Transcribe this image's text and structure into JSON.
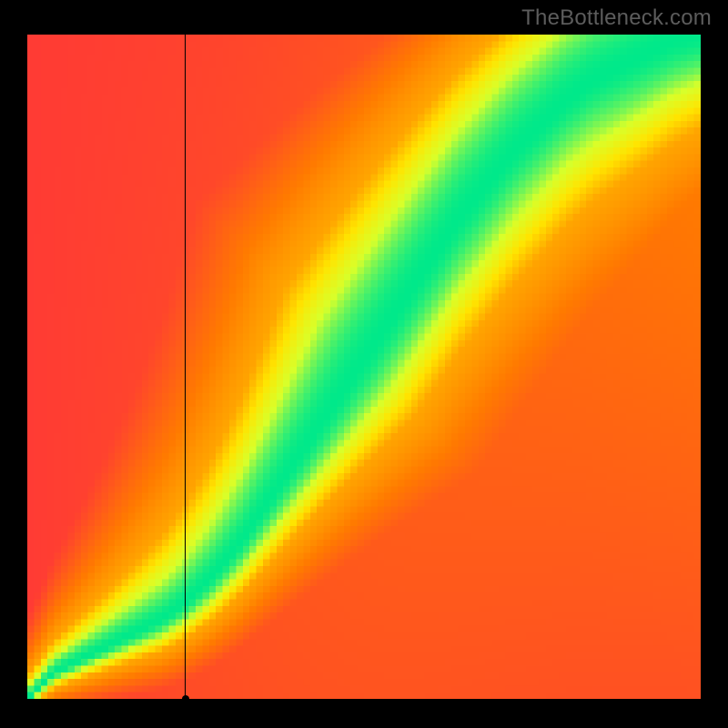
{
  "watermark": "TheBottleneck.com",
  "chart_data": {
    "type": "heatmap",
    "title": "",
    "xlabel": "",
    "ylabel": "",
    "xlim": [
      0,
      100
    ],
    "ylim": [
      0,
      100
    ],
    "grid": false,
    "legend": false,
    "color_scale": [
      "#ff1a4f",
      "#ff6a00",
      "#ffd400",
      "#e6ff1a",
      "#00e98a"
    ],
    "optimal_ridge": {
      "description": "Green optimal band through the heatmap; coordinates are (x%, y%) of plot area from bottom-left.",
      "points": [
        [
          0,
          0
        ],
        [
          4,
          4
        ],
        [
          8,
          6
        ],
        [
          12,
          8
        ],
        [
          16,
          10
        ],
        [
          20,
          12
        ],
        [
          24,
          15
        ],
        [
          28,
          19
        ],
        [
          32,
          24
        ],
        [
          36,
          30
        ],
        [
          40,
          36
        ],
        [
          44,
          42
        ],
        [
          48,
          48
        ],
        [
          52,
          54
        ],
        [
          56,
          60
        ],
        [
          60,
          66
        ],
        [
          64,
          72
        ],
        [
          68,
          77
        ],
        [
          72,
          82
        ],
        [
          76,
          86
        ],
        [
          80,
          90
        ],
        [
          84,
          93
        ],
        [
          88,
          95
        ],
        [
          92,
          97
        ],
        [
          96,
          99
        ],
        [
          100,
          100
        ]
      ],
      "band_halfwidth_pct_at_50": 4
    },
    "crosshair": {
      "x_pct": 23.5,
      "y_pct": 0,
      "marker": true
    },
    "pixel_resolution": 100
  },
  "colors": {
    "background": "#000000",
    "watermark": "#5c5c5c",
    "red": "#ff1a4f",
    "orange": "#ff7a00",
    "yellow": "#ffe400",
    "yellowgreen": "#d8ff2a",
    "green": "#00e98a"
  }
}
